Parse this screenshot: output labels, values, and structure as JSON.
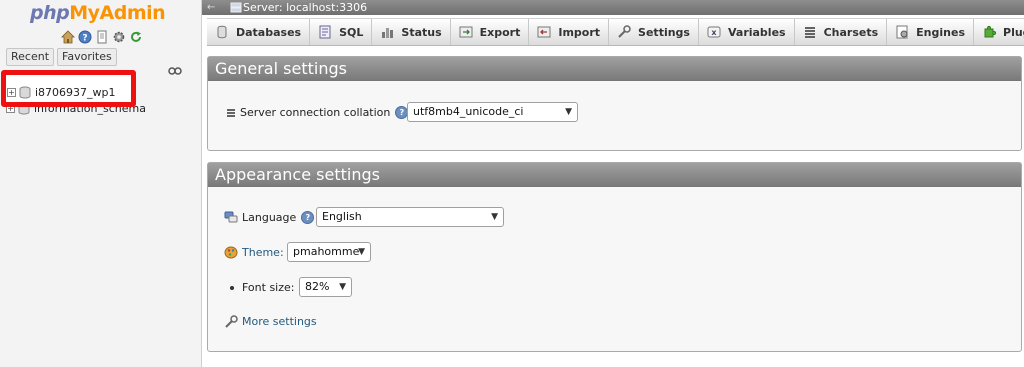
{
  "nav": {
    "logo_php": "php",
    "logo_myadmin": "MyAdmin",
    "icons": [
      "home-icon",
      "help-icon",
      "docs-icon",
      "settings-icon",
      "reload-icon"
    ],
    "tabs": [
      "Recent",
      "Favorites"
    ],
    "databases": [
      {
        "name": "i8706937_wp1"
      },
      {
        "name": "information_schema"
      }
    ]
  },
  "topbar": {
    "collapse": "←",
    "server_label": "Server: localhost:3306"
  },
  "menu": {
    "tabs": [
      {
        "label": "Databases",
        "icon": "databases-icon"
      },
      {
        "label": "SQL",
        "icon": "sql-icon"
      },
      {
        "label": "Status",
        "icon": "status-icon"
      },
      {
        "label": "Export",
        "icon": "export-icon"
      },
      {
        "label": "Import",
        "icon": "import-icon"
      },
      {
        "label": "Settings",
        "icon": "settings-icon"
      },
      {
        "label": "Variables",
        "icon": "variables-icon"
      },
      {
        "label": "Charsets",
        "icon": "charsets-icon"
      },
      {
        "label": "Engines",
        "icon": "engines-icon"
      },
      {
        "label": "Plugins",
        "icon": "plugins-icon"
      }
    ]
  },
  "general": {
    "title": "General settings",
    "collation_label": "Server connection collation",
    "collation_colon": ":",
    "collation_value": "utf8mb4_unicode_ci"
  },
  "appearance": {
    "title": "Appearance settings",
    "language_label": "Language",
    "language_value": "English",
    "theme_label": "Theme:",
    "theme_value": "pmahomme",
    "fontsize_label": "Font size:",
    "fontsize_value": "82%",
    "more_settings": "More settings"
  },
  "colors": {
    "highlight": "#ee1111",
    "logo_php": "#6c78af",
    "logo_myadmin": "#f89406",
    "link": "#235a81"
  }
}
